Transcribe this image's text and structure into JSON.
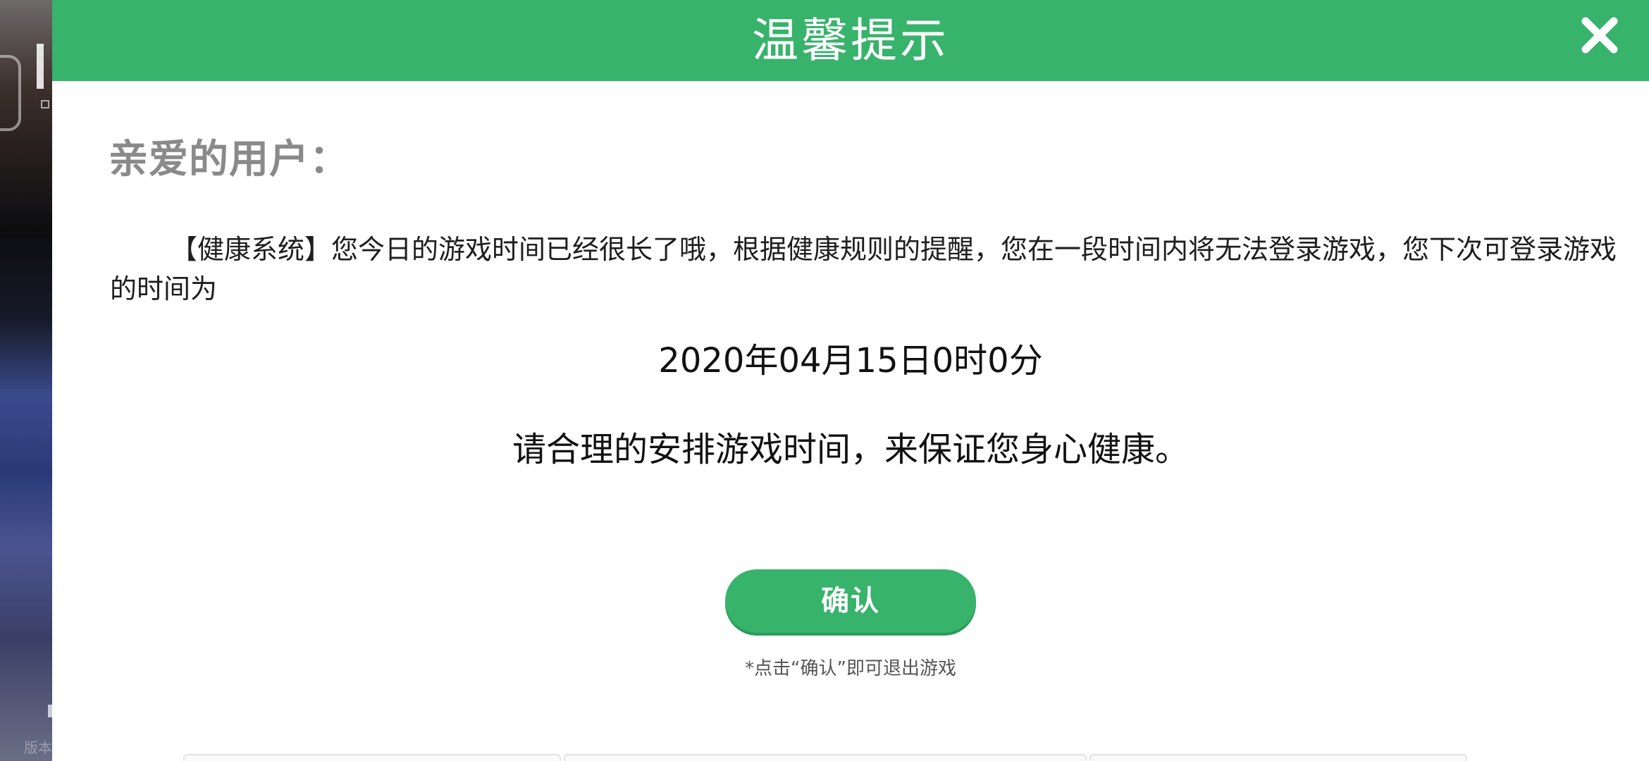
{
  "background": {
    "version_text": "版本"
  },
  "dialog": {
    "title": "温馨提示",
    "greeting": "亲爱的用户：",
    "message": "【健康系统】您今日的游戏时间已经很长了哦，根据健康规则的提醒，您在一段时间内将无法登录游戏，您下次可登录游戏的时间为",
    "next_login_time": "2020年04月15日0时0分",
    "advice": "请合理的安排游戏时间，来保证您身心健康。",
    "confirm_label": "确认",
    "exit_note": "*点击“确认”即可退出游戏",
    "close_icon": "close-icon"
  },
  "colors": {
    "accent": "#37b36b",
    "greeting_text": "#8a8a8a",
    "body_text": "#1e1e1e"
  }
}
